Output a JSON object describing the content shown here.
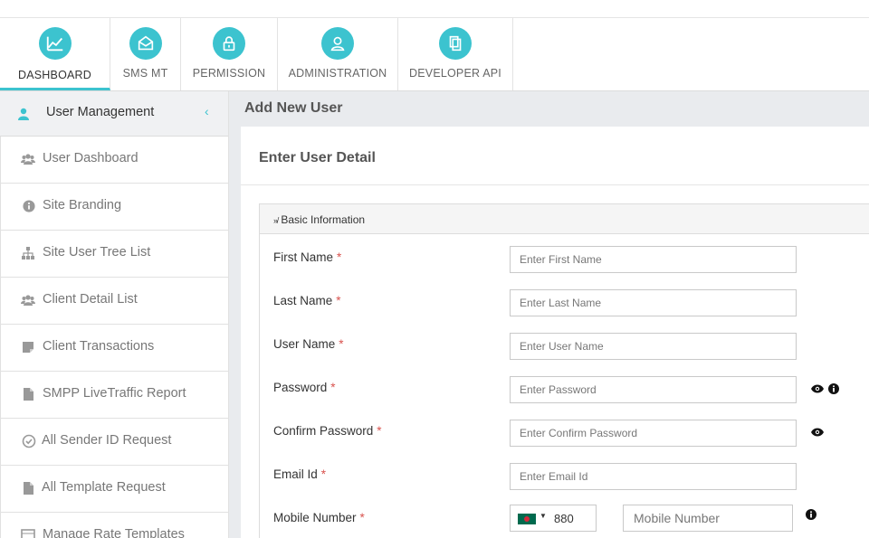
{
  "nav": {
    "items": [
      {
        "label": "DASHBOARD",
        "icon": "chart-line-icon"
      },
      {
        "label": "SMS MT",
        "icon": "envelope-icon"
      },
      {
        "label": "PERMISSION",
        "icon": "lock-icon"
      },
      {
        "label": "ADMINISTRATION",
        "icon": "user-icon"
      },
      {
        "label": "DEVELOPER API",
        "icon": "documents-icon"
      }
    ],
    "active": "DASHBOARD"
  },
  "sidebar": {
    "title": "User Management",
    "items": [
      {
        "label": "User Dashboard",
        "icon": "users-icon"
      },
      {
        "label": "Site Branding",
        "icon": "info-circle-icon"
      },
      {
        "label": "Site User Tree List",
        "icon": "sitemap-icon"
      },
      {
        "label": "Client Detail List",
        "icon": "users-icon"
      },
      {
        "label": "Client Transactions",
        "icon": "sticky-note-icon"
      },
      {
        "label": "SMPP LiveTraffic Report",
        "icon": "file-icon"
      },
      {
        "label": "All Sender ID Request",
        "icon": "check-circle-icon"
      },
      {
        "label": "All Template Request",
        "icon": "file-icon"
      },
      {
        "label": "Manage Rate Templates",
        "icon": "table-icon"
      }
    ]
  },
  "content": {
    "page_title": "Add New User",
    "card_title": "Enter User Detail",
    "panel_title": "Basic Information",
    "fields": [
      {
        "label": "First Name",
        "required": "*",
        "placeholder": "Enter First Name"
      },
      {
        "label": "Last Name",
        "required": "*",
        "placeholder": "Enter Last Name"
      },
      {
        "label": "User Name",
        "required": "*",
        "placeholder": "Enter User Name"
      },
      {
        "label": "Password",
        "required": "*",
        "placeholder": "Enter Password"
      },
      {
        "label": "Confirm Password",
        "required": "*",
        "placeholder": "Enter Confirm Password"
      },
      {
        "label": "Email Id",
        "required": "*",
        "placeholder": "Enter Email Id"
      }
    ],
    "mobile": {
      "label": "Mobile Number",
      "required": "*",
      "country_code": "880",
      "placeholder": "Mobile Number"
    }
  },
  "colors": {
    "accent": "#3cc3cf",
    "required": "#d9534f",
    "content_bg": "#e9ebee"
  }
}
